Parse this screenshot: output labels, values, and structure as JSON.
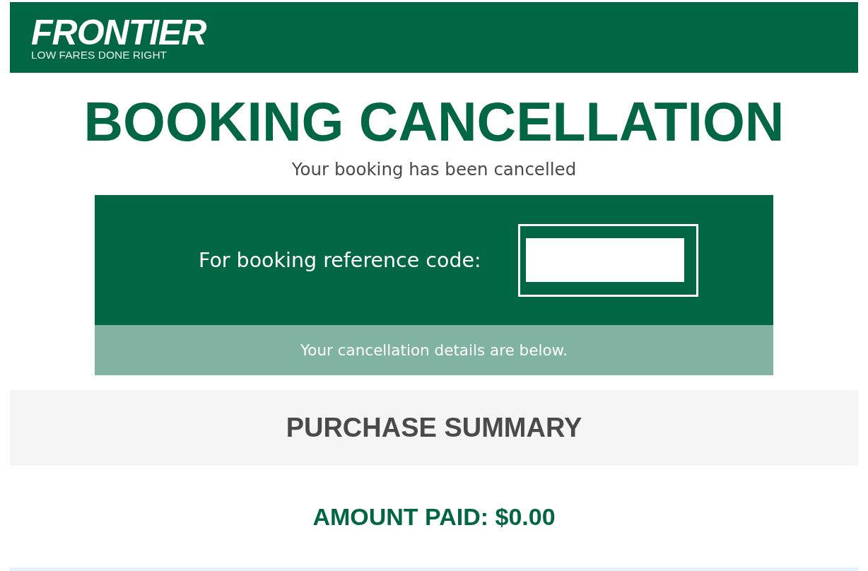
{
  "header": {
    "logo": {
      "wordmark": "FRONTIER",
      "tagline": "LOW FARES DONE RIGHT"
    }
  },
  "title": "BOOKING CANCELLATION",
  "subtitle": "Your booking has been cancelled",
  "reference_panel": {
    "label": "For booking reference code:",
    "note": "Your cancellation details are below."
  },
  "purchase_summary": {
    "heading": "PURCHASE SUMMARY",
    "amount_paid": "AMOUNT PAID: $0.00"
  }
}
